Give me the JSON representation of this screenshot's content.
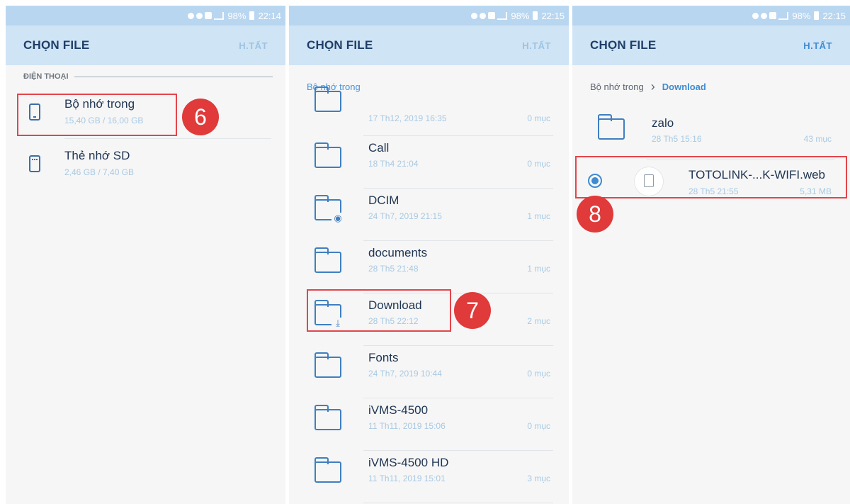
{
  "statusbars": [
    {
      "battery": "98%",
      "time": "22:14"
    },
    {
      "battery": "98%",
      "time": "22:15"
    },
    {
      "battery": "98%",
      "time": "22:15"
    }
  ],
  "panel1": {
    "title": "CHỌN FILE",
    "action": "H.TẤT",
    "section": "ĐIỆN THOẠI",
    "items": [
      {
        "name": "Bộ nhớ trong",
        "size": "15,40 GB / 16,00 GB",
        "icon": "phone-icon"
      },
      {
        "name": "Thẻ nhớ SD",
        "size": "2,46 GB / 7,40 GB",
        "icon": "sd-card-icon"
      }
    ],
    "step": "6"
  },
  "panel2": {
    "title": "CHỌN FILE",
    "action": "H.TẤT",
    "breadcrumb": "Bộ nhớ trong",
    "partial_item": {
      "date": "17 Th12, 2019 16:35",
      "count": "0 mục"
    },
    "items": [
      {
        "name": "Call",
        "date": "18 Th4 21:04",
        "count": "0 mục",
        "icon": "folder-icon"
      },
      {
        "name": "DCIM",
        "date": "24 Th7, 2019 21:15",
        "count": "1 mục",
        "icon": "camera-folder-icon"
      },
      {
        "name": "documents",
        "date": "28 Th5 21:48",
        "count": "1 mục",
        "icon": "folder-icon"
      },
      {
        "name": "Download",
        "date": "28 Th5 22:12",
        "count": "2 mục",
        "icon": "download-folder-icon"
      },
      {
        "name": "Fonts",
        "date": "24 Th7, 2019 10:44",
        "count": "0 mục",
        "icon": "folder-icon"
      },
      {
        "name": "iVMS-4500",
        "date": "11 Th11, 2019 15:06",
        "count": "0 mục",
        "icon": "folder-icon"
      },
      {
        "name": "iVMS-4500 HD",
        "date": "11 Th11, 2019 15:01",
        "count": "3 mục",
        "icon": "folder-icon"
      }
    ],
    "step": "7"
  },
  "panel3": {
    "title": "CHỌN FILE",
    "action": "H.TẤT",
    "breadcrumbs": [
      "Bộ nhớ trong",
      "Download"
    ],
    "folder": {
      "name": "zalo",
      "date": "28 Th5 15:16",
      "count": "43 mục"
    },
    "file": {
      "name": "TOTOLINK-...K-WIFI.web",
      "date": "28 Th5 21:55",
      "size": "5,31 MB",
      "selected": true
    },
    "step": "8"
  },
  "colors": {
    "header": "#cfe4f5",
    "statusbar": "#b9d6f0",
    "accent": "#3e8bd3",
    "highlight": "#e3454b",
    "step_badge": "#e03a3a"
  }
}
